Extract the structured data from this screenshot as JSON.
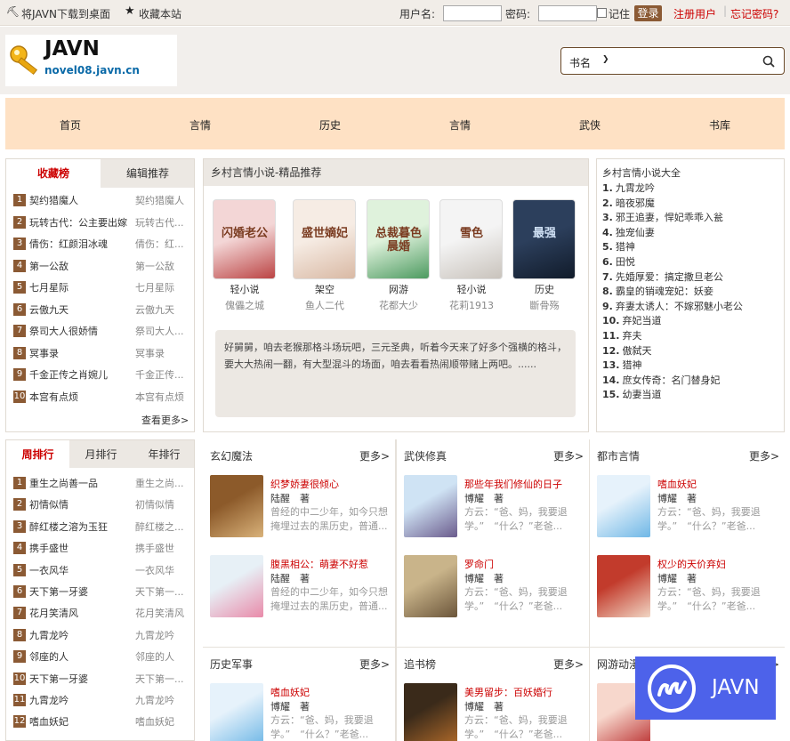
{
  "topbar": {
    "download": "将JAVN下载到桌面",
    "favorite": "收藏本站",
    "username_label": "用户名:",
    "password_label": "密码:",
    "remember": "记住",
    "login": "登录",
    "register": "注册用户",
    "forgot": "忘记密码?"
  },
  "header": {
    "logo_title": "JAVN",
    "logo_sub": "novel08.javn.cn",
    "search_type": "书名"
  },
  "nav": [
    "首页",
    "言情",
    "历史",
    "言情",
    "武侠",
    "书库"
  ],
  "rank1": {
    "tabs": [
      "收藏榜",
      "编辑推荐"
    ],
    "rows": [
      {
        "n": "1",
        "name": "契约猎魔人",
        "alt": "契约猎魔人"
      },
      {
        "n": "2",
        "name": "玩转古代：公主要出嫁",
        "alt": "玩转古代..."
      },
      {
        "n": "3",
        "name": "倩伤：红颜泪冰魂",
        "alt": "倩伤：红..."
      },
      {
        "n": "4",
        "name": "第一公敌",
        "alt": "第一公敌"
      },
      {
        "n": "5",
        "name": "七月星际",
        "alt": "七月星际"
      },
      {
        "n": "6",
        "name": "云傲九天",
        "alt": "云傲九天"
      },
      {
        "n": "7",
        "name": "祭司大人很娇情",
        "alt": "祭司大人..."
      },
      {
        "n": "8",
        "name": "冥事录",
        "alt": "冥事录"
      },
      {
        "n": "9",
        "name": "千金正传之肖婉儿",
        "alt": "千金正传..."
      },
      {
        "n": "10",
        "name": "本宫有点烦",
        "alt": "本宫有点烦"
      }
    ],
    "more": "查看更多>"
  },
  "featured": {
    "title": "乡村言情小说-精品推荐",
    "books": [
      {
        "cat": "轻小说",
        "author": "傀儡之城",
        "cover_text": "闪婚老公",
        "c1": "#f3d6d6",
        "c2": "#b44"
      },
      {
        "cat": "架空",
        "author": "鱼人二代",
        "cover_text": "盛世嫡妃",
        "c1": "#f6ece4",
        "c2": "#d9b9a4"
      },
      {
        "cat": "网游",
        "author": "花都大少",
        "cover_text": "总裁暮色晨婚",
        "c1": "#dff2dc",
        "c2": "#4d9a60"
      },
      {
        "cat": "轻小说",
        "author": "花莉1913",
        "cover_text": "雪色",
        "c1": "#f4f4f4",
        "c2": "#c9c3bc"
      },
      {
        "cat": "历史",
        "author": "斷骨殇",
        "cover_text": "最强",
        "c1": "#2c3f5c",
        "c2": "#111b2a"
      }
    ],
    "intro": "好舅舅，咱去老猴那格斗场玩吧，三元圣典，听着今天来了好多个强横的格斗，要大大热闹一翻，有大型混斗的场面，咱去看看热闹顺带赌上两吧。......"
  },
  "rightlist": {
    "title": "乡村言情小说大全",
    "items": [
      {
        "n": "1.",
        "t": "九霄龙吟"
      },
      {
        "n": "2.",
        "t": "暗夜邪魔"
      },
      {
        "n": "3.",
        "t": "邪王追妻，悍妃乖乖入瓮"
      },
      {
        "n": "4.",
        "t": "独宠仙妻"
      },
      {
        "n": "5.",
        "t": "猎神"
      },
      {
        "n": "6.",
        "t": "田悦"
      },
      {
        "n": "7.",
        "t": "先婚厚爱：搞定撒旦老公"
      },
      {
        "n": "8.",
        "t": "霸皇的销魂宠妃：妖妾"
      },
      {
        "n": "9.",
        "t": "弃妻太诱人：不嫁邪魅小老公"
      },
      {
        "n": "10.",
        "t": "弃妃当道"
      },
      {
        "n": "11.",
        "t": "弃夫"
      },
      {
        "n": "12.",
        "t": "傲弑天"
      },
      {
        "n": "13.",
        "t": "猎神"
      },
      {
        "n": "14.",
        "t": "庶女传奇：名门替身妃"
      },
      {
        "n": "15.",
        "t": "幼妻当道"
      }
    ]
  },
  "rank2": {
    "tabs": [
      "周排行",
      "月排行",
      "年排行"
    ],
    "rows": [
      {
        "n": "1",
        "name": "重生之尚善一品",
        "alt": "重生之尚..."
      },
      {
        "n": "2",
        "name": "初情似情",
        "alt": "初情似情"
      },
      {
        "n": "3",
        "name": "醉红楼之溶为玉狂",
        "alt": "醉红楼之..."
      },
      {
        "n": "4",
        "name": "携手盛世",
        "alt": "携手盛世"
      },
      {
        "n": "5",
        "name": "一衣风华",
        "alt": "一衣风华"
      },
      {
        "n": "6",
        "name": "天下第一牙婆",
        "alt": "天下第一..."
      },
      {
        "n": "7",
        "name": "花月笑清风",
        "alt": "花月笑清风"
      },
      {
        "n": "8",
        "name": "九霄龙吟",
        "alt": "九霄龙吟"
      },
      {
        "n": "9",
        "name": "邻座的人",
        "alt": "邻座的人"
      },
      {
        "n": "10",
        "name": "天下第一牙婆",
        "alt": "天下第一..."
      },
      {
        "n": "11",
        "name": "九霄龙吟",
        "alt": "九霄龙吟"
      },
      {
        "n": "12",
        "name": "嗜血妖妃",
        "alt": "嗜血妖妃"
      }
    ]
  },
  "grid": [
    {
      "head": "玄幻魔法",
      "more": "更多>",
      "books": [
        {
          "title": "织梦娇妻很倾心",
          "author": "陆醒　著",
          "desc": "曾经的中二少年，如今只想掩埋过去的黑历史，普通...",
          "c1": "#8c5a2a",
          "c2": "#d9b27a"
        },
        {
          "title": "腹黑相公：萌妻不好惹",
          "author": "陆醒　著",
          "desc": "曾经的中二少年，如今只想掩埋过去的黑历史，普通...",
          "c1": "#e7f0f6",
          "c2": "#e98aa9"
        }
      ]
    },
    {
      "head": "武侠修真",
      "more": "更多>",
      "books": [
        {
          "title": "那些年我们修仙的日子",
          "author": "博耀　著",
          "desc": "方云：“爸、妈，我要退学。”　“什么？”老爸...",
          "c1": "#cfe3f4",
          "c2": "#6a5b8c"
        },
        {
          "title": "罗命门",
          "author": "博耀　著",
          "desc": "方云：“爸、妈，我要退学。”　“什么？”老爸...",
          "c1": "#c9b48a",
          "c2": "#6b553a"
        }
      ]
    },
    {
      "head": "都市言情",
      "more": "更多>",
      "books": [
        {
          "title": "嗜血妖妃",
          "author": "博耀　著",
          "desc": "方云：“爸、妈，我要退学。”　“什么？”老爸...",
          "c1": "#e6f2fb",
          "c2": "#6fb7e6"
        },
        {
          "title": "权少的天价弃妇",
          "author": "博耀　著",
          "desc": "方云：“爸、妈，我要退学。”　“什么？”老爸...",
          "c1": "#c23b2c",
          "c2": "#f1d6c4"
        }
      ]
    },
    {
      "head": "历史军事",
      "more": "更多>",
      "books": [
        {
          "title": "嗜血妖妃",
          "author": "博耀　著",
          "desc": "方云：“爸、妈，我要退学。”　“什么？”老爸...",
          "c1": "#e6f2fb",
          "c2": "#6fb7e6"
        }
      ]
    },
    {
      "head": "追书榜",
      "more": "更多>",
      "books": [
        {
          "title": "美男留步：百妖婚行",
          "author": "博耀　著",
          "desc": "方云：“爸、妈，我要退学。”　“什么？”老爸...",
          "c1": "#3a2a1a",
          "c2": "#b06a2a"
        }
      ]
    },
    {
      "head": "网游动漫",
      "more": "更多>",
      "books": [
        {
          "title": "",
          "author": "",
          "desc": "",
          "c1": "#f7d7cc",
          "c2": "#b33"
        }
      ]
    }
  ],
  "overlay": {
    "text": "JAVN"
  },
  "colors": {
    "brown": "#8b5a34",
    "nav_bg": "#fee1c4",
    "red": "#cc0000",
    "overlay": "#4d62ea"
  }
}
